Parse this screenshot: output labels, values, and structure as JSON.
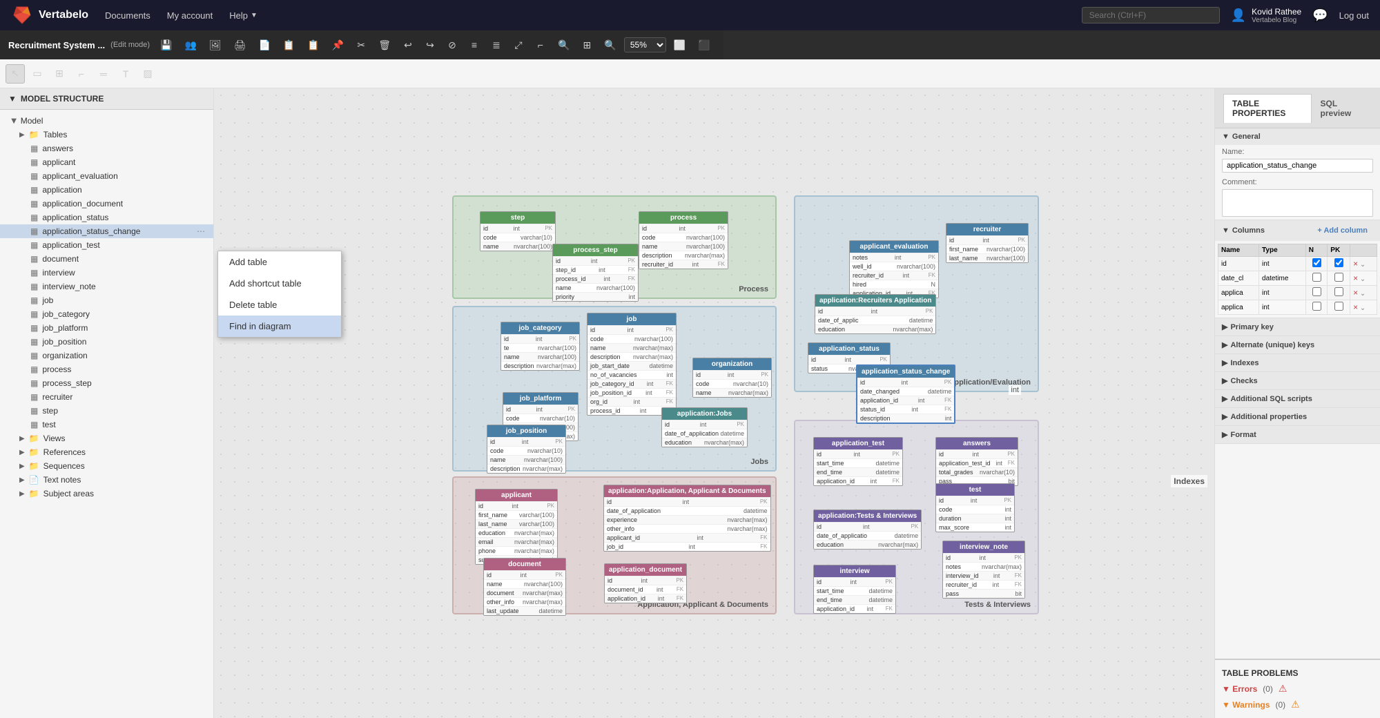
{
  "app": {
    "name": "Vertabelo",
    "title": "Recruitment System ...",
    "edit_mode": "(Edit mode)"
  },
  "nav": {
    "documents": "Documents",
    "my_account": "My account",
    "help": "Help",
    "user_name": "Kovid Rathee",
    "user_blog": "Vertabelo Blog",
    "logout": "Log out",
    "search_placeholder": "Search (Ctrl+F)"
  },
  "toolbar": {
    "zoom": "55%",
    "tools": [
      "select",
      "rectangle",
      "table",
      "corner",
      "horizontal",
      "text",
      "crosshatch"
    ]
  },
  "sidebar": {
    "header": "MODEL STRUCTURE",
    "model_label": "Model",
    "tables_label": "Tables",
    "tables": [
      "answers",
      "applicant",
      "applicant_evaluation",
      "application",
      "application_document",
      "application_status",
      "application_status_change",
      "application_test",
      "document",
      "interview",
      "interview_note",
      "job",
      "job_category",
      "job_platform",
      "job_position",
      "organization",
      "process",
      "process_step",
      "recruiter",
      "step",
      "test"
    ],
    "views_label": "Views",
    "references_label": "References",
    "sequences_label": "Sequences",
    "text_notes_label": "Text notes",
    "subject_areas_label": "Subject areas",
    "indexes_label": "Indexes"
  },
  "context_menu": {
    "add_table": "Add table",
    "add_shortcut_table": "Add shortcut table",
    "delete_table": "Delete table",
    "find_in_diagram": "Find in diagram"
  },
  "right_panel": {
    "header": "TABLE PROPERTIES",
    "sql_preview": "SQL preview",
    "general_label": "General",
    "name_label": "Name:",
    "name_value": "application_status_change",
    "comment_label": "Comment:",
    "columns_label": "Columns",
    "add_column_label": "+ Add column",
    "columns": [
      {
        "name": "id",
        "type": "int",
        "n": true,
        "pk": true
      },
      {
        "name": "date_cl",
        "type": "datetime",
        "n": false,
        "pk": false
      },
      {
        "name": "applica",
        "type": "int",
        "n": false,
        "pk": false
      },
      {
        "name": "applica",
        "type": "int",
        "n": false,
        "pk": false
      }
    ],
    "primary_key_label": "Primary key",
    "alternate_keys_label": "Alternate (unique) keys",
    "indexes_label": "Indexes",
    "checks_label": "Checks",
    "additional_sql_label": "Additional SQL scripts",
    "additional_props_label": "Additional properties",
    "format_label": "Format"
  },
  "table_problems": {
    "header": "TABLE PROBLEMS",
    "errors_label": "Errors",
    "errors_count": "(0)",
    "warnings_label": "Warnings",
    "warnings_count": "(0)"
  },
  "diagram": {
    "regions": [
      {
        "id": "process",
        "label": "Process"
      },
      {
        "id": "jobs",
        "label": "Jobs"
      },
      {
        "id": "app_docs",
        "label": "Application, Applicant & Documents"
      },
      {
        "id": "recruiters",
        "label": "Recruiters Application/Evaluation"
      },
      {
        "id": "tests",
        "label": "Tests & Interviews"
      }
    ]
  }
}
